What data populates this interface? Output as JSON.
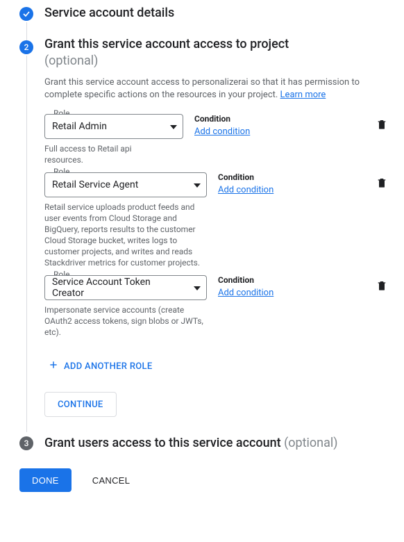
{
  "steps": {
    "s1": {
      "title": "Service account details"
    },
    "s2": {
      "number": "2",
      "title": "Grant this service account access to project",
      "optional": "(optional)",
      "description_prefix": "Grant this service account access to personalizerai so that it has permission to complete specific actions on the resources in your project. ",
      "learn_more": "Learn more"
    },
    "s3": {
      "number": "3",
      "title": "Grant users access to this service account ",
      "optional": "(optional)"
    }
  },
  "role_field_label": "Role",
  "condition_label": "Condition",
  "add_condition_label": "Add condition",
  "roles": [
    {
      "value": "Retail Admin",
      "helper": "Full access to Retail api resources."
    },
    {
      "value": "Retail Service Agent",
      "helper": "Retail service uploads product feeds and user events from Cloud Storage and BigQuery, reports results to the customer Cloud Storage bucket, writes logs to customer projects, and writes and reads Stackdriver metrics for customer projects."
    },
    {
      "value": "Service Account Token Creator",
      "helper": "Impersonate service accounts (create OAuth2 access tokens, sign blobs or JWTs, etc)."
    }
  ],
  "add_role_label": "ADD ANOTHER ROLE",
  "continue_label": "CONTINUE",
  "done_label": "DONE",
  "cancel_label": "CANCEL"
}
